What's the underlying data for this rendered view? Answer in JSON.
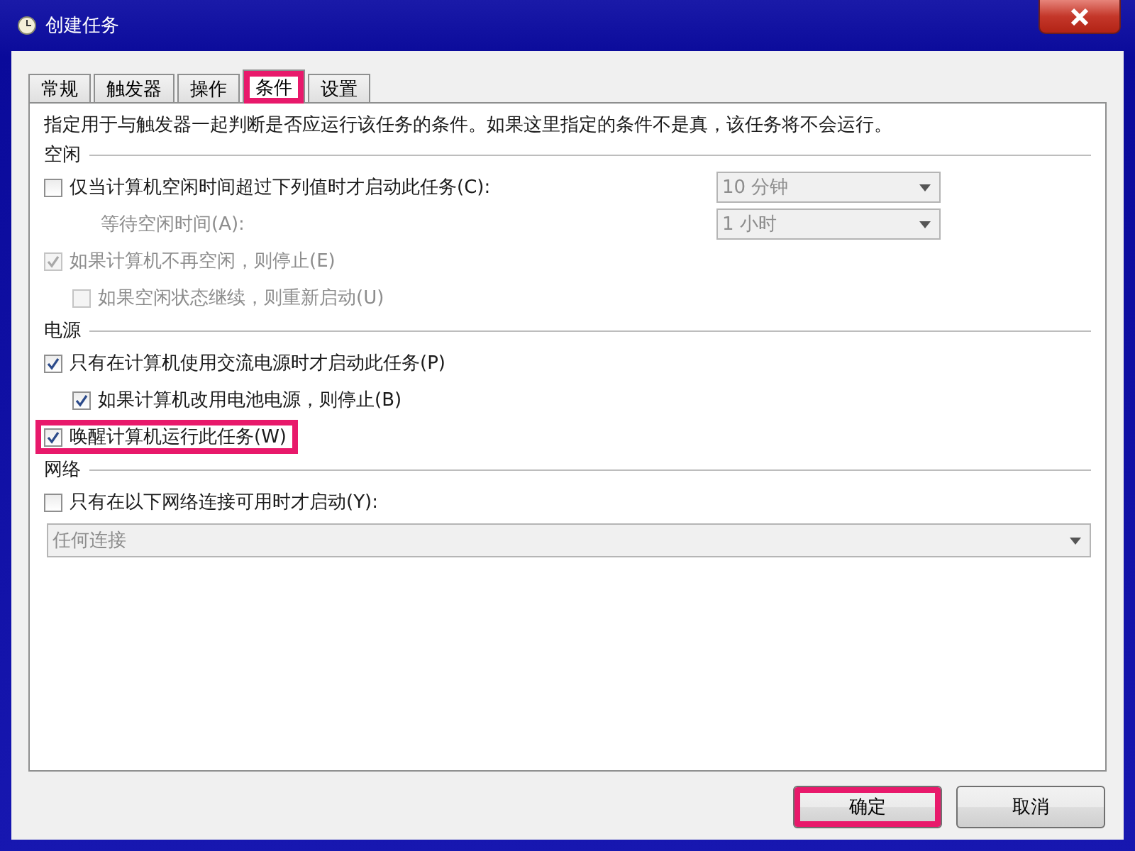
{
  "window": {
    "title": "创建任务"
  },
  "tabs": [
    {
      "label": "常规",
      "selected": false,
      "highlighted": false
    },
    {
      "label": "触发器",
      "selected": false,
      "highlighted": false
    },
    {
      "label": "操作",
      "selected": false,
      "highlighted": false
    },
    {
      "label": "条件",
      "selected": true,
      "highlighted": true
    },
    {
      "label": "设置",
      "selected": false,
      "highlighted": false
    }
  ],
  "description": "指定用于与触发器一起判断是否应运行该任务的条件。如果这里指定的条件不是真，该任务将不会运行。",
  "sections": [
    {
      "title": "空闲",
      "items": [
        {
          "kind": "checkbox",
          "label": "仅当计算机空闲时间超过下列值时才启动此任务(C):",
          "checked": false,
          "disabled": false,
          "highlighted": false,
          "dropdown": {
            "value": "10 分钟",
            "disabled": true
          }
        },
        {
          "kind": "field",
          "label": "等待空闲时间(A):",
          "disabled": true,
          "dropdown": {
            "value": "1 小时",
            "disabled": true
          }
        },
        {
          "kind": "checkbox",
          "label": "如果计算机不再空闲，则停止(E)",
          "checked": true,
          "disabled": true,
          "highlighted": false,
          "children": [
            {
              "kind": "checkbox",
              "label": "如果空闲状态继续，则重新启动(U)",
              "checked": false,
              "disabled": true,
              "highlighted": false
            }
          ]
        }
      ]
    },
    {
      "title": "电源",
      "items": [
        {
          "kind": "checkbox",
          "label": "只有在计算机使用交流电源时才启动此任务(P)",
          "checked": true,
          "disabled": false,
          "highlighted": false,
          "children": [
            {
              "kind": "checkbox",
              "label": "如果计算机改用电池电源，则停止(B)",
              "checked": true,
              "disabled": false,
              "highlighted": false
            }
          ]
        },
        {
          "kind": "checkbox",
          "label": "唤醒计算机运行此任务(W)",
          "checked": true,
          "disabled": false,
          "highlighted": true
        }
      ]
    },
    {
      "title": "网络",
      "items": [
        {
          "kind": "checkbox",
          "label": "只有在以下网络连接可用时才启动(Y):",
          "checked": false,
          "disabled": false,
          "highlighted": false
        },
        {
          "kind": "wide-dropdown",
          "value": "任何连接",
          "disabled": true
        }
      ]
    }
  ],
  "buttons": [
    {
      "label": "确定",
      "highlighted": true
    },
    {
      "label": "取消",
      "highlighted": false
    }
  ]
}
